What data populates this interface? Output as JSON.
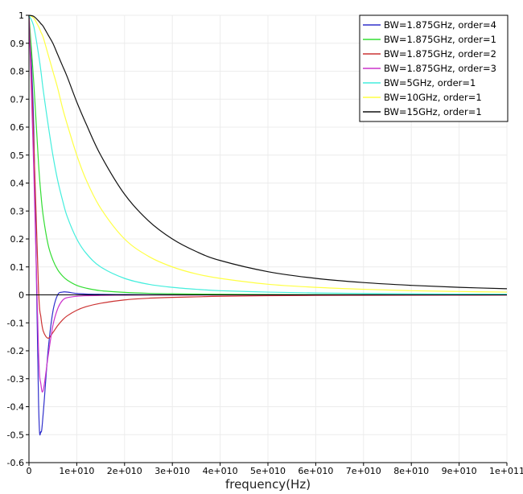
{
  "chart_data": {
    "type": "line",
    "title": "",
    "xlabel": "frequency(Hz)",
    "ylabel": "",
    "xlim": [
      0,
      100000000000
    ],
    "ylim": [
      -0.6,
      1
    ],
    "grid": true,
    "legend_position": "top-right",
    "x_ticks": [
      0,
      10000000000,
      20000000000,
      30000000000,
      40000000000,
      50000000000,
      60000000000,
      70000000000,
      80000000000,
      90000000000,
      100000000000
    ],
    "x_tick_labels": [
      "0",
      "1e+010",
      "2e+010",
      "3e+010",
      "4e+010",
      "5e+010",
      "6e+010",
      "7e+010",
      "8e+010",
      "9e+010",
      "1e+011"
    ],
    "y_ticks": [
      -0.6,
      -0.5,
      -0.4,
      -0.3,
      -0.2,
      -0.1,
      0,
      0.1,
      0.2,
      0.3,
      0.4,
      0.5,
      0.6,
      0.7,
      0.8,
      0.9,
      1
    ],
    "y_tick_labels": [
      "-0.6",
      "-0.5",
      "-0.4",
      "-0.3",
      "-0.2",
      "-0.1",
      "0",
      "0.1",
      "0.2",
      "0.3",
      "0.4",
      "0.5",
      "0.6",
      "0.7",
      "0.8",
      "0.9",
      "1"
    ],
    "x": [
      0,
      1000000000,
      2000000000,
      2500000000,
      3000000000,
      4000000000,
      5000000000,
      6000000000,
      7000000000,
      8000000000,
      10000000000,
      12000000000,
      15000000000,
      20000000000,
      25000000000,
      30000000000,
      35000000000,
      40000000000,
      50000000000,
      60000000000,
      70000000000,
      80000000000,
      90000000000,
      100000000000
    ],
    "series": [
      {
        "name": "BW=1.875GHz, order=4",
        "color": "#3030cc",
        "values": [
          1.0,
          0.6,
          -0.38,
          -0.49,
          -0.42,
          -0.2,
          -0.06,
          0.0,
          0.01,
          0.01,
          0.005,
          0.003,
          0.002,
          0.001,
          0.0005,
          0.0004,
          0.0003,
          0.0002,
          0.0001,
          0.0001,
          0.0001,
          0.0,
          0.0,
          0.0
        ]
      },
      {
        "name": "BW=1.875GHz, order=1",
        "color": "#33dd33",
        "values": [
          1.0,
          0.76,
          0.47,
          0.36,
          0.28,
          0.18,
          0.125,
          0.09,
          0.068,
          0.053,
          0.034,
          0.024,
          0.015,
          0.009,
          0.0056,
          0.0039,
          0.0029,
          0.0022,
          0.0014,
          0.001,
          0.0007,
          0.0005,
          0.0004,
          0.0003
        ]
      },
      {
        "name": "BW=1.875GHz, order=2",
        "color": "#cc3333",
        "values": [
          1.0,
          0.55,
          0.02,
          -0.08,
          -0.13,
          -0.155,
          -0.135,
          -0.11,
          -0.09,
          -0.075,
          -0.055,
          -0.042,
          -0.03,
          -0.018,
          -0.012,
          -0.009,
          -0.007,
          -0.005,
          -0.003,
          -0.002,
          -0.0015,
          -0.001,
          -0.0008,
          -0.0006
        ]
      },
      {
        "name": "BW=1.875GHz, order=3",
        "color": "#cc33cc",
        "values": [
          1.0,
          0.45,
          -0.2,
          -0.32,
          -0.34,
          -0.22,
          -0.11,
          -0.05,
          -0.02,
          -0.01,
          -0.005,
          -0.003,
          -0.002,
          -0.001,
          -0.0005,
          -0.0004,
          -0.0003,
          -0.0002,
          -0.0001,
          0.0,
          0.0,
          0.0,
          0.0,
          0.0
        ]
      },
      {
        "name": "BW=5GHz, order=1",
        "color": "#44eedd",
        "values": [
          1.0,
          0.96,
          0.86,
          0.8,
          0.73,
          0.61,
          0.5,
          0.41,
          0.34,
          0.28,
          0.2,
          0.148,
          0.1,
          0.059,
          0.038,
          0.027,
          0.02,
          0.015,
          0.0099,
          0.0069,
          0.0051,
          0.0039,
          0.0031,
          0.0025
        ]
      },
      {
        "name": "BW=10GHz, order=1",
        "color": "#ffff44",
        "values": [
          1.0,
          0.99,
          0.96,
          0.94,
          0.92,
          0.86,
          0.8,
          0.74,
          0.67,
          0.61,
          0.5,
          0.41,
          0.31,
          0.2,
          0.138,
          0.1,
          0.075,
          0.059,
          0.038,
          0.027,
          0.02,
          0.015,
          0.012,
          0.0099
        ]
      },
      {
        "name": "BW=15GHz, order=1",
        "color": "#111111",
        "values": [
          1.0,
          0.996,
          0.98,
          0.97,
          0.96,
          0.93,
          0.9,
          0.86,
          0.82,
          0.78,
          0.69,
          0.61,
          0.5,
          0.36,
          0.265,
          0.2,
          0.155,
          0.123,
          0.083,
          0.059,
          0.044,
          0.034,
          0.027,
          0.022
        ]
      }
    ]
  }
}
